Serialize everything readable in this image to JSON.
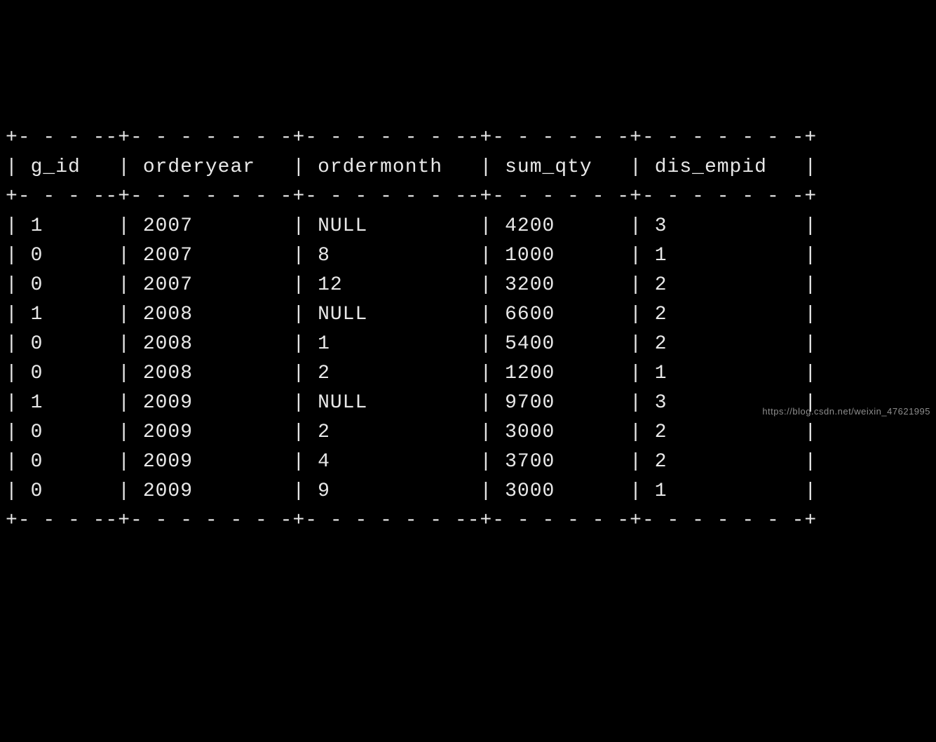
{
  "table": {
    "columns": [
      "g_id",
      "orderyear",
      "ordermonth",
      "sum_qty",
      "dis_empid"
    ],
    "widths": [
      6,
      11,
      12,
      9,
      11
    ],
    "rows": [
      [
        "1",
        "2007",
        "NULL",
        "4200",
        "3"
      ],
      [
        "0",
        "2007",
        "8",
        "1000",
        "1"
      ],
      [
        "0",
        "2007",
        "12",
        "3200",
        "2"
      ],
      [
        "1",
        "2008",
        "NULL",
        "6600",
        "2"
      ],
      [
        "0",
        "2008",
        "1",
        "5400",
        "2"
      ],
      [
        "0",
        "2008",
        "2",
        "1200",
        "1"
      ],
      [
        "1",
        "2009",
        "NULL",
        "9700",
        "3"
      ],
      [
        "0",
        "2009",
        "2",
        "3000",
        "2"
      ],
      [
        "0",
        "2009",
        "4",
        "3700",
        "2"
      ],
      [
        "0",
        "2009",
        "9",
        "3000",
        "1"
      ]
    ]
  },
  "watermark_text": "https://blog.csdn.net/weixin_47621995",
  "chart_data": {
    "type": "table",
    "columns": [
      "g_id",
      "orderyear",
      "ordermonth",
      "sum_qty",
      "dis_empid"
    ],
    "rows": [
      {
        "g_id": 1,
        "orderyear": 2007,
        "ordermonth": null,
        "sum_qty": 4200,
        "dis_empid": 3
      },
      {
        "g_id": 0,
        "orderyear": 2007,
        "ordermonth": 8,
        "sum_qty": 1000,
        "dis_empid": 1
      },
      {
        "g_id": 0,
        "orderyear": 2007,
        "ordermonth": 12,
        "sum_qty": 3200,
        "dis_empid": 2
      },
      {
        "g_id": 1,
        "orderyear": 2008,
        "ordermonth": null,
        "sum_qty": 6600,
        "dis_empid": 2
      },
      {
        "g_id": 0,
        "orderyear": 2008,
        "ordermonth": 1,
        "sum_qty": 5400,
        "dis_empid": 2
      },
      {
        "g_id": 0,
        "orderyear": 2008,
        "ordermonth": 2,
        "sum_qty": 1200,
        "dis_empid": 1
      },
      {
        "g_id": 1,
        "orderyear": 2009,
        "ordermonth": null,
        "sum_qty": 9700,
        "dis_empid": 3
      },
      {
        "g_id": 0,
        "orderyear": 2009,
        "ordermonth": 2,
        "sum_qty": 3000,
        "dis_empid": 2
      },
      {
        "g_id": 0,
        "orderyear": 2009,
        "ordermonth": 4,
        "sum_qty": 3700,
        "dis_empid": 2
      },
      {
        "g_id": 0,
        "orderyear": 2009,
        "ordermonth": 9,
        "sum_qty": 3000,
        "dis_empid": 1
      }
    ]
  }
}
